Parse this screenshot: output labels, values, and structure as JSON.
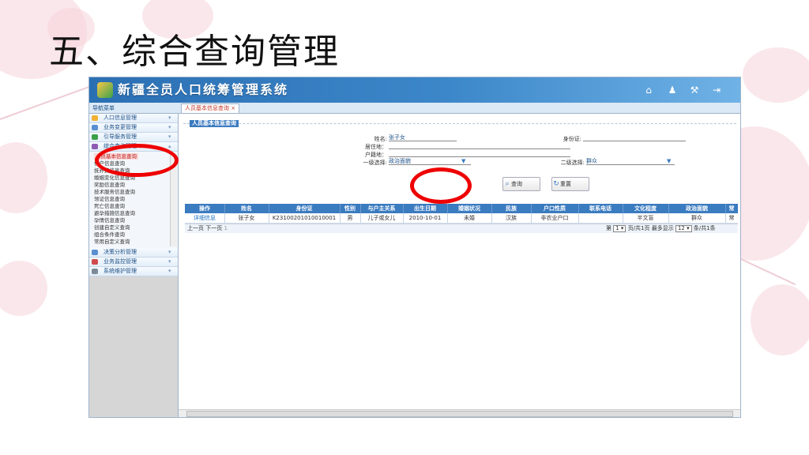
{
  "slide": {
    "title": "五、综合查询管理"
  },
  "header": {
    "title": "新疆全员人口统筹管理系统",
    "icons": [
      "home-icon",
      "bell-icon",
      "tools-icon",
      "logout-icon"
    ]
  },
  "nav": {
    "title": "导航菜单"
  },
  "tab": {
    "label": "人员基本信息查询 ×"
  },
  "sidebar": {
    "top_items": [
      "人口信息管理",
      "业务变更管理",
      "引导服务管理",
      "综合查询管理"
    ],
    "sub_items": [
      "人员基本信息查询",
      "住户信息查询",
      "抚养费信息查询",
      "婚姻变化信息查询",
      "奖励信息查询",
      "技术服务信息查询",
      "领证信息查询",
      "死亡信息查询",
      "避孕措施信息查询",
      "孕情信息查询",
      "创建自定义查询",
      "组合条件查询",
      "常用自定义查询"
    ],
    "bottom_items": [
      "决策分析管理",
      "业务监控管理",
      "系统维护管理"
    ]
  },
  "form": {
    "legend": "人员基本信息查询",
    "name_label": "姓名:",
    "name_value": "张子女",
    "idcard_label": "身份证:",
    "residence_label": "居住地：",
    "hukou_label": "户籍地：",
    "level1_label": "一级选择:",
    "level1_value": "政治面貌",
    "level2_label": "二级选择:",
    "level2_value": "群众",
    "query_button": "查询",
    "reset_button": "重置"
  },
  "table": {
    "headers": [
      "操作",
      "姓名",
      "身份证",
      "性别",
      "与户主关系",
      "出生日期",
      "婚姻状况",
      "民族",
      "户口性质",
      "联系电话",
      "文化程度",
      "政治面貌",
      "常"
    ],
    "rows": [
      [
        "详细信息",
        "张子女",
        "K23100201010010001",
        "男",
        "儿子或女儿",
        "2010-10-01",
        "未婚",
        "汉族",
        "非农业户口",
        "",
        "半文盲",
        "群众",
        "常"
      ]
    ]
  },
  "pager": {
    "nav": "上一页 下一页",
    "page_num": "1",
    "page_prefix": "第",
    "page_current": "1",
    "page_suffix": "页/共1页",
    "show_label": "最多显示",
    "show_value": "12",
    "total": "条/共1条"
  },
  "colors": {
    "header": "#3c87c9",
    "highlight": "#e00000",
    "table_header": "#3b7bc0"
  }
}
